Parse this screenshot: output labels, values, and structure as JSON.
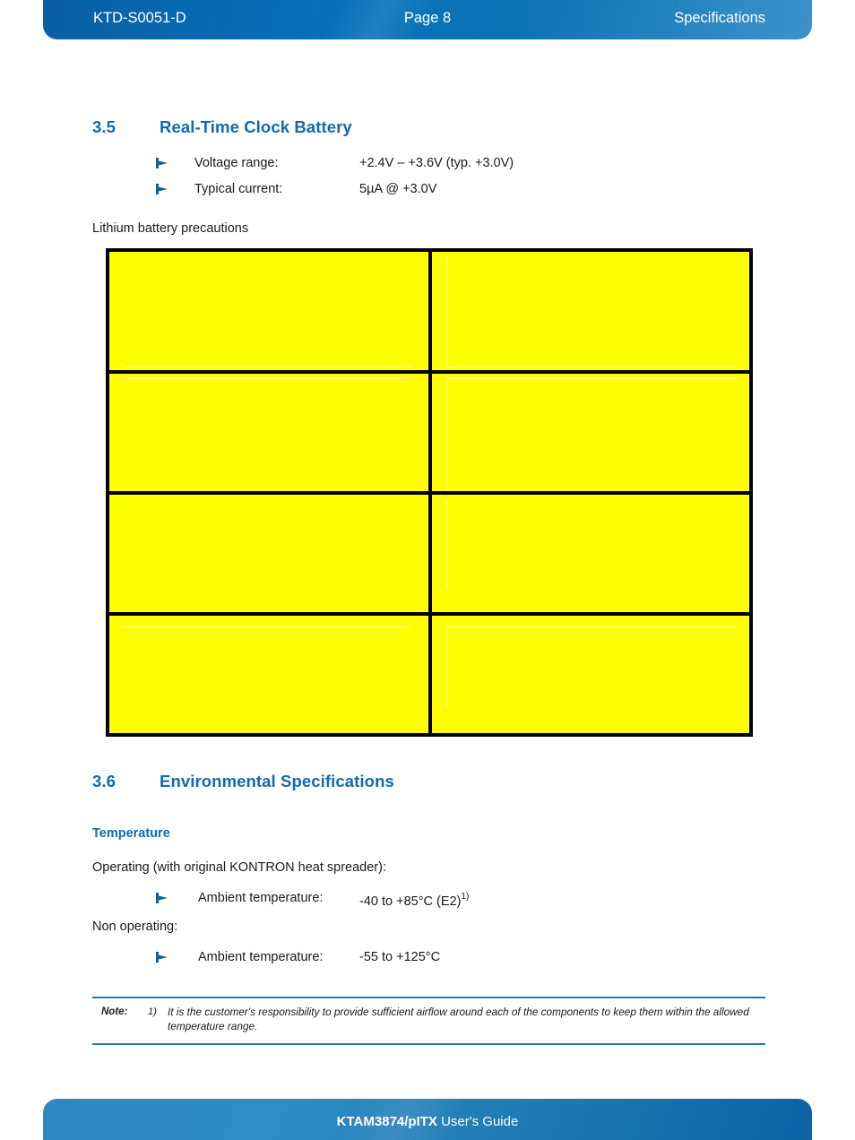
{
  "header": {
    "doc_id": "KTD-S0051-D",
    "page_label": "Page 8",
    "section": "Specifications",
    "accent_color": "#0571b9"
  },
  "sections": {
    "rtc": {
      "number": "3.5",
      "title": "Real-Time Clock Battery",
      "specs": [
        {
          "label": "Voltage range:",
          "value": "+2.4V – +3.6V  (typ. +3.0V)"
        },
        {
          "label": "Typical current:",
          "value": "5µA @ +3.0V"
        }
      ],
      "precautions_caption": "Lithium battery precautions",
      "precautions_table": {
        "rows": [
          {
            "left": "",
            "right": ""
          },
          {
            "left": "",
            "right": ""
          },
          {
            "left": "",
            "right": ""
          },
          {
            "left": "",
            "right": ""
          }
        ],
        "cell_color": "#ffff00",
        "border_color": "#000000"
      }
    },
    "environmental": {
      "number": "3.6",
      "title": "Environmental Specifications",
      "subheading": "Temperature",
      "operating_caption": "Operating (with original KONTRON heat spreader):",
      "operating_spec": {
        "label": "Ambient temperature:",
        "value": "-40 to +85°C  (E2)",
        "footnote_marker": "1)"
      },
      "non_operating_caption": "Non operating:",
      "non_operating_spec": {
        "label": "Ambient temperature:",
        "value": "-55 to +125°C",
        "footnote_marker": ""
      }
    }
  },
  "note": {
    "label": "Note:",
    "marker": "1)",
    "text": "It is the customer's responsibility to provide sufficient airflow around each of the components to keep them within the allowed temperature range.",
    "rule_color": "#1f7ab5"
  },
  "footer": {
    "product": "KTAM3874/pITX",
    "suffix": " User's Guide"
  }
}
